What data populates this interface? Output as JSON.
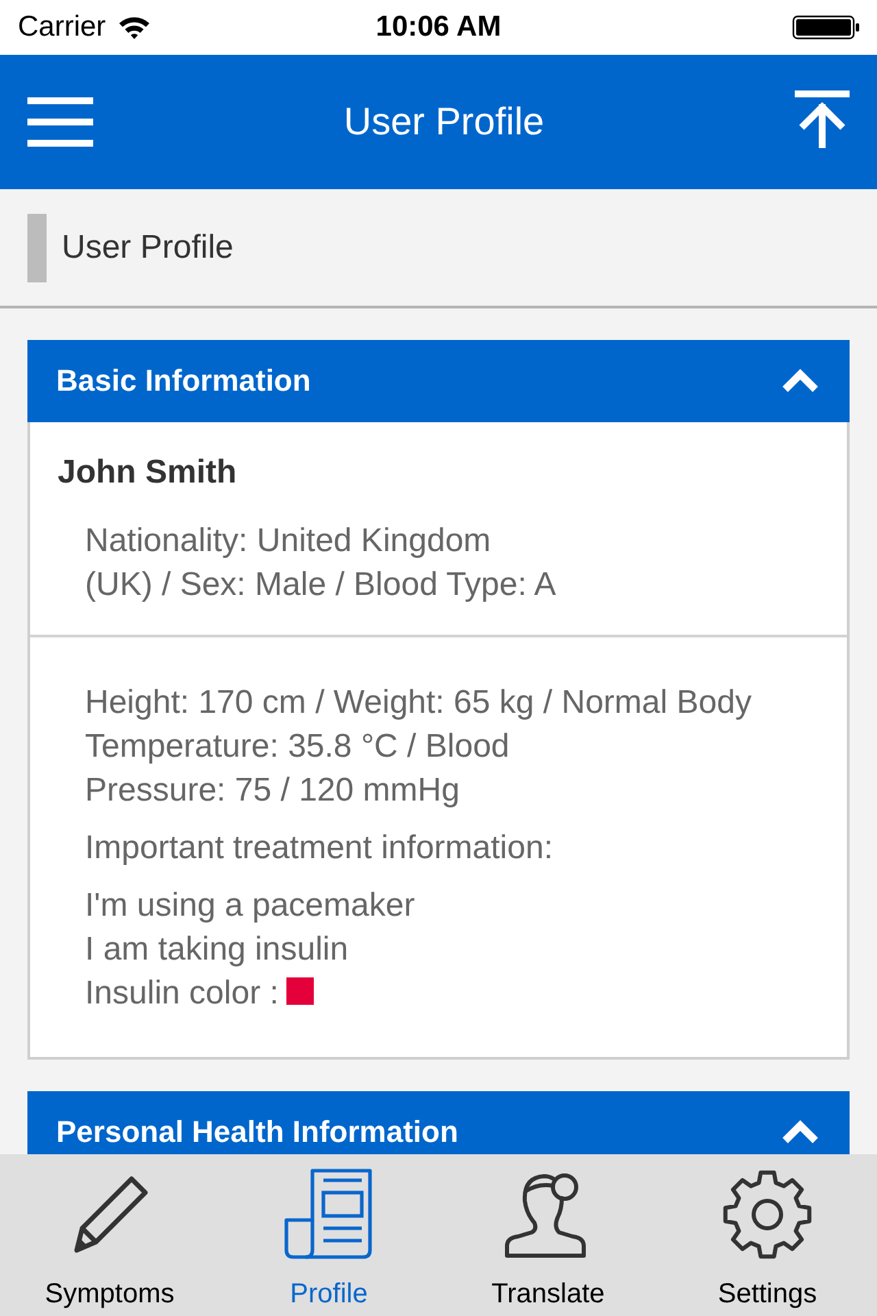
{
  "status_bar": {
    "carrier": "Carrier",
    "time": "10:06 AM"
  },
  "nav_bar": {
    "title": "User Profile"
  },
  "breadcrumb": {
    "label": "User Profile"
  },
  "panels": [
    {
      "title": "Basic Information",
      "expanded": true,
      "name": "John Smith",
      "details": [
        "Nationality: United Kingdom",
        "(UK) / Sex: Male / Blood Type: A"
      ],
      "vitals": [
        "Height: 170 cm / Weight: 65 kg / Normal Body",
        "Temperature: 35.8 °C / Blood",
        "Pressure: 75 / 120 mmHg"
      ],
      "treatment": {
        "heading": "Important treatment information:",
        "items": [
          "I'm using a pacemaker",
          "I am taking insulin"
        ],
        "insulin_color": {
          "label": "Insulin color :",
          "color": "#e4003a"
        }
      }
    },
    {
      "title": "Personal Health Information",
      "expanded": true
    }
  ],
  "tab_bar": [
    {
      "label": "Symptoms",
      "kind": "pencil",
      "selected": false
    },
    {
      "label": "Profile",
      "kind": "document",
      "selected": true
    },
    {
      "label": "Translate",
      "kind": "person",
      "selected": false
    },
    {
      "label": "Settings",
      "kind": "gear",
      "selected": false
    }
  ]
}
